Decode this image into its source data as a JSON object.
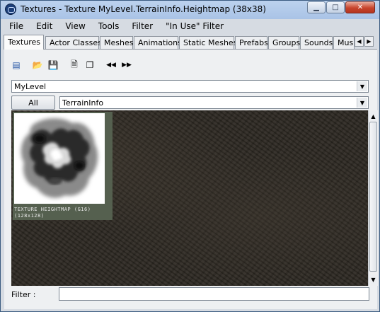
{
  "window": {
    "title": "Textures - Texture MyLevel.TerrainInfo.Heightmap (38x38)",
    "buttons": {
      "minimize": "▁",
      "maximize": "□",
      "close": "✕"
    }
  },
  "menu": [
    "File",
    "Edit",
    "View",
    "Tools",
    "Filter",
    "\"In Use\" Filter"
  ],
  "tabs": [
    "Textures",
    "Actor Classes",
    "Meshes",
    "Animations",
    "Static Meshes",
    "Prefabs",
    "Groups",
    "Sounds",
    "Mus"
  ],
  "tab_scroll": {
    "left": "◀",
    "right": "▶"
  },
  "toolbar": {
    "icons": [
      "browse-icon",
      "open-icon",
      "save-icon",
      "properties-icon",
      "copy-icon",
      "prev-icon",
      "next-icon"
    ],
    "glyphs": [
      "▤",
      "📂",
      "💾",
      "🗎",
      "❐",
      "◀◀",
      "▶▶"
    ]
  },
  "package_combo": {
    "value": "MyLevel"
  },
  "group_combo": {
    "value": "TerrainInfo"
  },
  "all_button": "All",
  "texture_item": {
    "label_line1": "TEXTURE HEIGHTMAP (G16)",
    "label_line2": "(128x128)"
  },
  "scrollbar": {
    "up": "▲",
    "down": "▼"
  },
  "filter": {
    "label": "Filter :",
    "value": ""
  }
}
